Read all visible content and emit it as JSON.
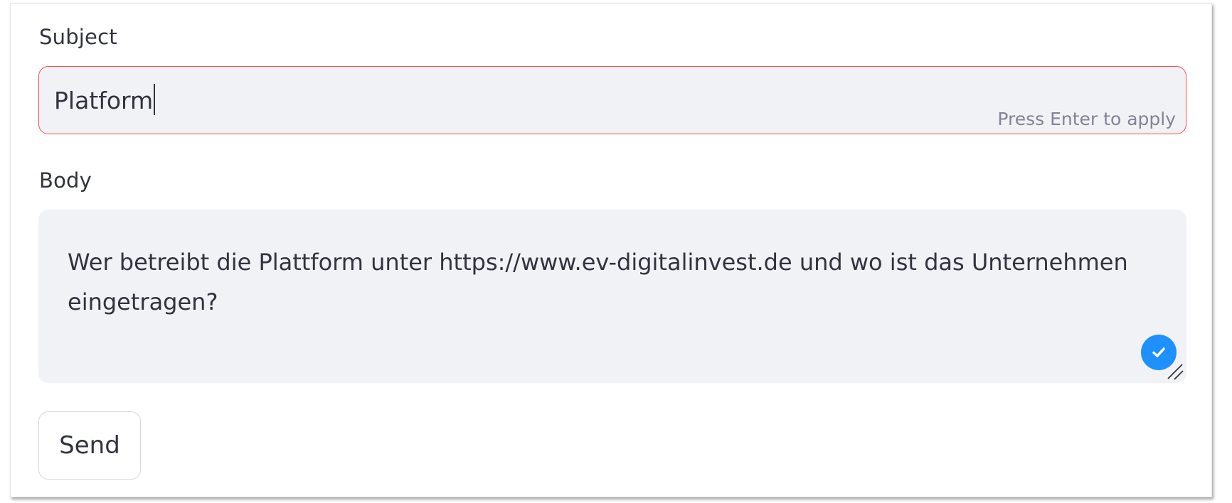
{
  "form": {
    "subject": {
      "label": "Subject",
      "value": "Platform",
      "hint": "Press Enter to apply",
      "border_color": "#ff4b4b"
    },
    "body": {
      "label": "Body",
      "value": "Wer betreibt die Plattform unter https://www.ev-digitalinvest.de und wo ist das Unternehmen eingetragen?",
      "status_icon": "check-circle-icon",
      "status_color": "#1e90ff"
    },
    "send_label": "Send"
  },
  "colors": {
    "input_background": "#f0f2f6",
    "text": "#31333f",
    "hint_text": "#808495"
  }
}
